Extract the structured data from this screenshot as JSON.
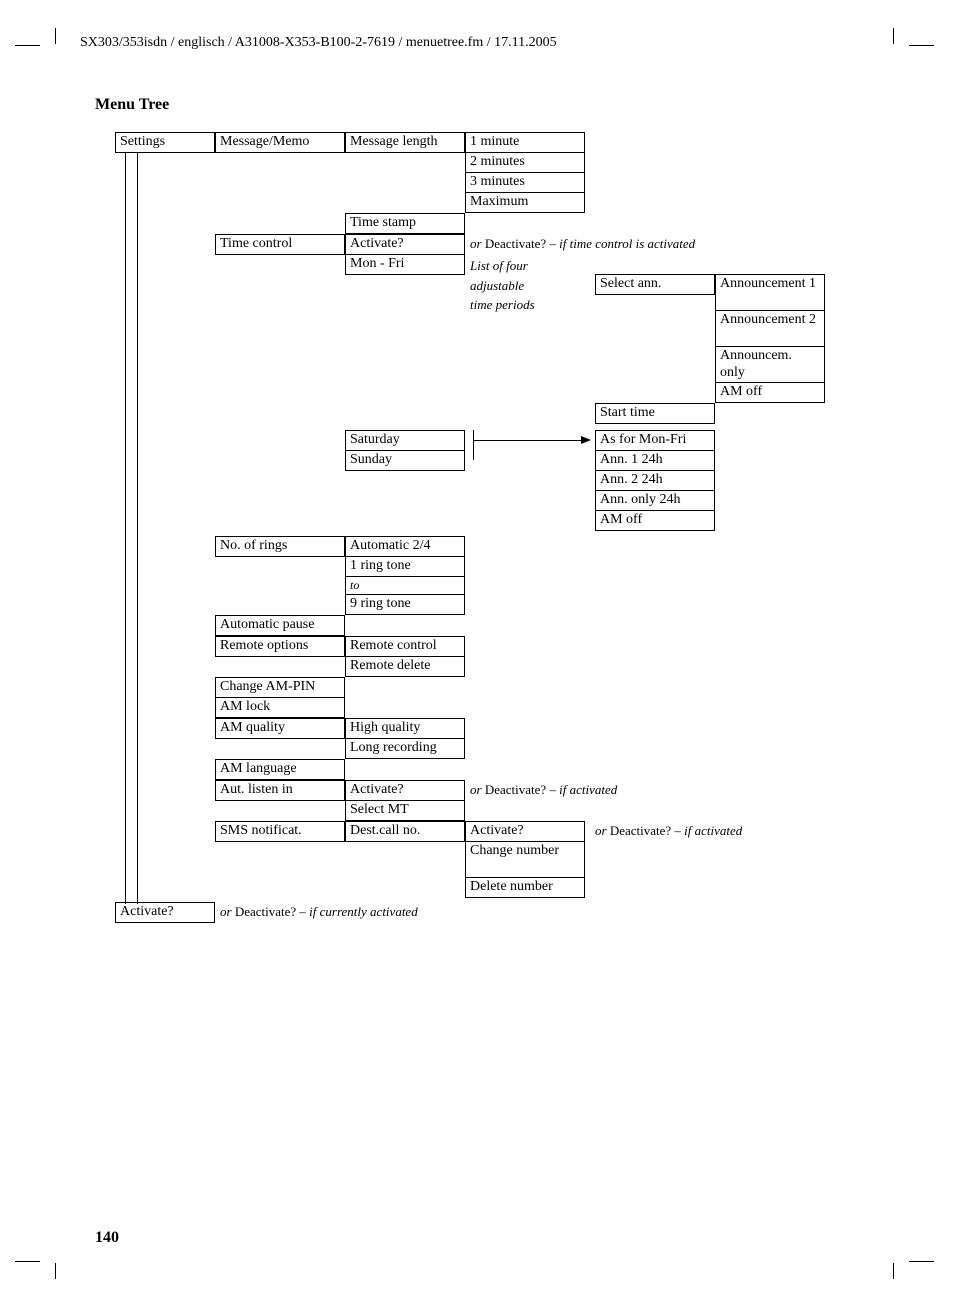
{
  "header": "SX303/353isdn / englisch / A31008-X353-B100-2-7619 / menuetree.fm / 17.11.2005",
  "section_title": "Menu Tree",
  "page_number": "140",
  "col1": {
    "settings": "Settings",
    "activate": "Activate?"
  },
  "col2": {
    "message_memo": "Message/Memo",
    "time_control": "Time control",
    "no_of_rings": "No. of rings",
    "automatic_pause": "Automatic pause",
    "remote_options": "Remote options",
    "change_am_pin": "Change AM-PIN",
    "am_lock": "AM lock",
    "am_quality": "AM quality",
    "am_language": "AM language",
    "aut_listen_in": "Aut. listen in",
    "sms_notificat": "SMS notificat."
  },
  "col3": {
    "message_length": "Message length",
    "time_stamp": "Time stamp",
    "activate1": "Activate?",
    "mon_fri": "Mon - Fri",
    "saturday": "Saturday",
    "sunday": "Sunday",
    "automatic_24": "Automatic 2/4",
    "one_ring": "1 ring tone",
    "to": "to",
    "nine_ring": "9 ring tone",
    "remote_control": "Remote control",
    "remote_delete": "Remote delete",
    "high_quality": "High quality",
    "long_recording": "Long recording",
    "activate2": "Activate?",
    "select_mt": "Select MT",
    "dest_call": "Dest.call no."
  },
  "col4": {
    "one_minute": "1 minute",
    "two_minutes": "2 minutes",
    "three_minutes": "3 minutes",
    "maximum": "Maximum",
    "list_note_l1": "List of four",
    "list_note_l2": "adjustable",
    "list_note_l3": "time periods",
    "activate": "Activate?",
    "change_number": "Change number",
    "delete_number": "Delete number"
  },
  "col5": {
    "select_ann": "Select ann.",
    "start_time": "Start time",
    "as_for": "As for Mon-Fri",
    "ann1_24h": "Ann. 1  24h",
    "ann2_24h": "Ann. 2  24h",
    "ann_only_24h": "Ann. only 24h",
    "am_off": "AM off"
  },
  "col6": {
    "ann1": "Announcement 1",
    "ann2": "Announcement 2",
    "ann_only": "Announcem. only",
    "am_off": "AM off"
  },
  "notes": {
    "tc": {
      "or": "or ",
      "deact": "Deactivate?",
      "rest": " – if time control is activated"
    },
    "ali": {
      "or": "or ",
      "deact": "Deactivate?",
      "rest": " – if activated"
    },
    "sms": {
      "or": "or ",
      "deact": "Deactivate?",
      "rest": " – if activated"
    },
    "bottom": {
      "or": "or ",
      "deact": "Deactivate?",
      "rest": " – if currently activated"
    }
  }
}
